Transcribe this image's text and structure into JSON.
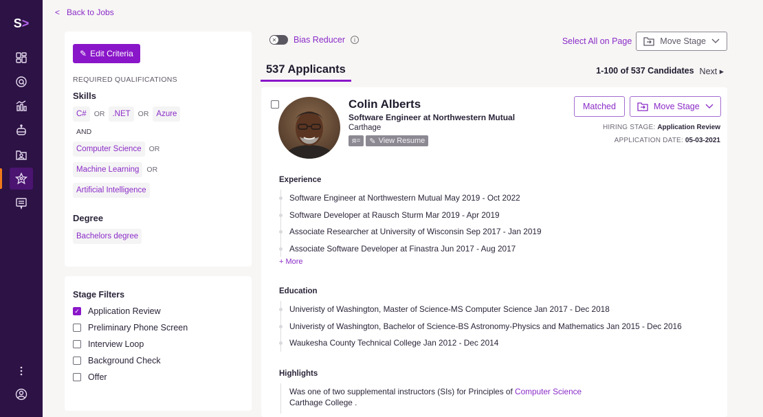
{
  "app": {
    "logo_letter": "S",
    "logo_chevron": ">",
    "nav": [
      {
        "name": "dashboard",
        "icon": "dashboard-icon"
      },
      {
        "name": "search",
        "icon": "search-icon"
      },
      {
        "name": "analytics",
        "icon": "analytics-icon"
      },
      {
        "name": "bot",
        "icon": "robot-icon"
      },
      {
        "name": "candidates-folder",
        "icon": "folder-user-icon"
      },
      {
        "name": "talent",
        "icon": "star-user-icon",
        "active": true
      },
      {
        "name": "messages",
        "icon": "message-icon"
      }
    ],
    "bottom_nav": [
      {
        "name": "more",
        "icon": "more-vertical-icon"
      },
      {
        "name": "profile",
        "icon": "user-circle-icon"
      }
    ],
    "accent": "#8a16c9",
    "sidebar_bg": "#2d1245",
    "active_indicator": "#f07b1a"
  },
  "back_link": {
    "chevron": "<",
    "label": "Back to Jobs"
  },
  "criteria": {
    "edit_label": "Edit Criteria",
    "required_label": "REQUIRED QUALIFICATIONS",
    "skills_heading": "Skills",
    "skills_group1": [
      {
        "label": "C#"
      },
      {
        "op": "OR"
      },
      {
        "label": ".NET"
      },
      {
        "op": "OR"
      },
      {
        "label": "Azure"
      }
    ],
    "and_label": "AND",
    "skills_group2": [
      {
        "label": "Computer Science",
        "op": "OR"
      },
      {
        "label": "Machine Learning",
        "op": "OR"
      },
      {
        "label": "Artificial Intelligence",
        "op": ""
      }
    ],
    "degree_heading": "Degree",
    "degree": "Bachelors degree"
  },
  "stage_filters": {
    "heading": "Stage Filters",
    "items": [
      {
        "label": "Application Review",
        "checked": true
      },
      {
        "label": "Preliminary Phone Screen",
        "checked": false
      },
      {
        "label": "Interview Loop",
        "checked": false
      },
      {
        "label": "Background Check",
        "checked": false
      },
      {
        "label": "Offer",
        "checked": false
      }
    ]
  },
  "toolbar": {
    "bias_reducer_label": "Bias Reducer",
    "bias_reducer_on": false,
    "info_glyph": "i",
    "select_all_label": "Select All on Page",
    "move_stage_label": "Move Stage"
  },
  "tabs": {
    "applicants": "537 Applicants"
  },
  "pagination": {
    "range": "1-100 of 537 Candidates",
    "next_label": "Next ▸"
  },
  "candidate": {
    "name": "Colin Alberts",
    "title": "Software Engineer at Northwestern Mutual",
    "location": "Carthage",
    "profile_tool": "ᴙ=",
    "view_resume_label": "View Resume",
    "matched_label": "Matched",
    "move_stage_label": "Move Stage",
    "hiring_stage_label": "HIRING STAGE:",
    "hiring_stage": "Application Review",
    "application_date_label": "APPLICATION DATE:",
    "application_date": "05-03-2021",
    "experience_heading": "Experience",
    "experience": [
      "Software Engineer at Northwestern Mutual May 2019 - Oct 2022",
      "Software Developer at Rausch Sturm Mar 2019 - Apr 2019",
      "Associate Researcher at University of Wisconsin Sep 2017 - Jan 2019",
      "Associate Software Developer at Finastra Jun 2017 - Aug 2017"
    ],
    "more_label": "+ More",
    "education_heading": "Education",
    "education": [
      "Univeristy of Washington, Master of Science-MS Computer Science Jan 2017 - Dec 2018",
      "Univeristy of Washington, Bachelor of Science-BS Astronomy-Physics and Mathematics Jan 2015 - Dec 2016",
      "Waukesha County Technical College Jan 2012 - Dec 2014"
    ],
    "highlights_heading": "Highlights",
    "highlight": {
      "prefix": "Was one of two supplemental instructors (SIs) for Principles of ",
      "keyword": "Computer  Science",
      "line2": "Carthage College ."
    }
  }
}
